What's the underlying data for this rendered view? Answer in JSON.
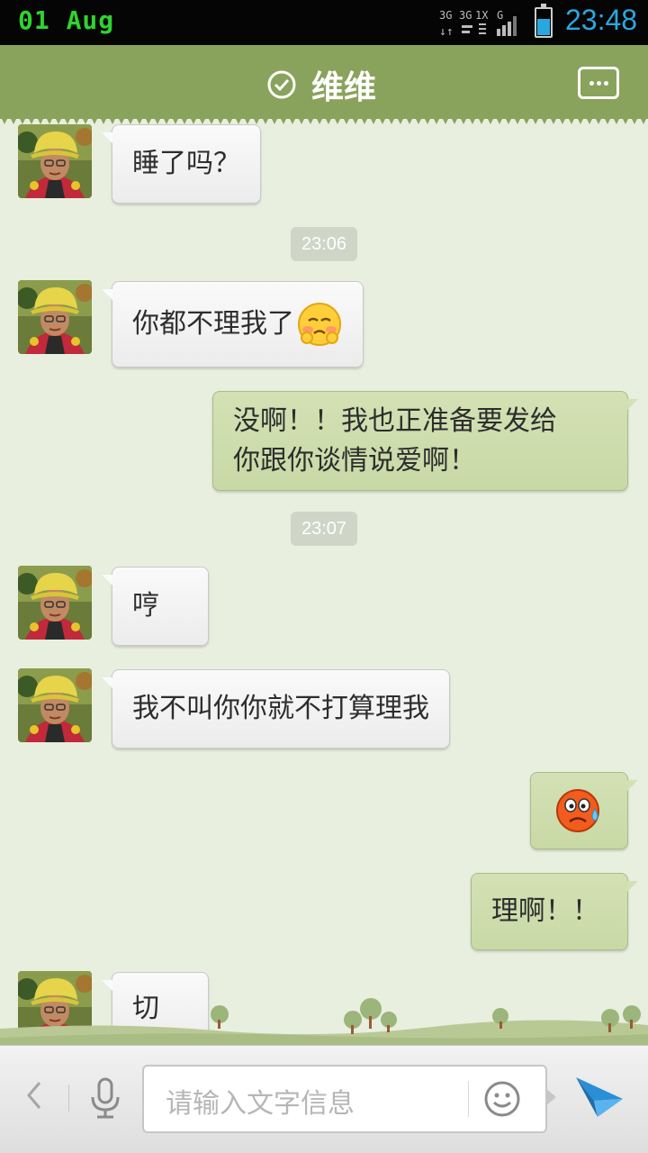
{
  "status_bar": {
    "date": "01 Aug",
    "network_labels": [
      "3G",
      "3G",
      "1X",
      "G"
    ],
    "time": "23:48",
    "battery_level": 0.6
  },
  "header": {
    "title": "维维"
  },
  "messages": [
    {
      "side": "in",
      "text": "睡了吗？"
    },
    {
      "timestamp": "23:06"
    },
    {
      "side": "in",
      "text": "你都不理我了",
      "emoji": "blush-face-icon"
    },
    {
      "side": "out",
      "lines": [
        "没啊！！我也正准备要发给",
        "你跟你谈情说爱啊！"
      ]
    },
    {
      "timestamp": "23:07"
    },
    {
      "side": "in",
      "text": "哼"
    },
    {
      "side": "in",
      "text": "我不叫你你就不打算理我"
    },
    {
      "side": "out",
      "emoji": "sweat-face-icon"
    },
    {
      "side": "out",
      "text": "理啊！！"
    },
    {
      "side": "in",
      "text": "切"
    }
  ],
  "input_bar": {
    "placeholder": "请输入文字信息"
  },
  "colors": {
    "header": "#8aa35c",
    "background": "#e8efdf",
    "outgoing_bubble": "#cfdfae",
    "incoming_bubble": "#f7f7f7",
    "accent": "#29a8e0",
    "date_green": "#2fd32f"
  },
  "icons": [
    "check-circle-icon",
    "more-icon",
    "back-chevron-icon",
    "microphone-icon",
    "smiley-icon",
    "send-icon"
  ]
}
